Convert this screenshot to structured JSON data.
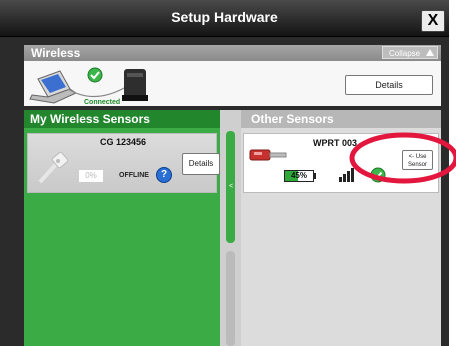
{
  "dialog": {
    "title": "Setup Hardware",
    "close_glyph": "X"
  },
  "wireless": {
    "header_label": "Wireless",
    "collapse_label": "Collapse",
    "status_text": "Connected",
    "details_label": "Details"
  },
  "my_sensors": {
    "header_label": "My Wireless Sensors",
    "cards": [
      {
        "name": "CG 123456",
        "percent": "0%",
        "status": "OFFLINE",
        "details_label": "Details",
        "help_glyph": "?"
      }
    ]
  },
  "other_sensors": {
    "header_label": "Other Sensors",
    "cards": [
      {
        "name": "WPRT 003",
        "battery_label": "45%",
        "battery_level": 0.45,
        "use_label_line1": "<- Use",
        "use_label_line2": "Sensor"
      }
    ]
  },
  "divider": {
    "scroll_arrow_glyph": "<"
  },
  "colors": {
    "accent_green": "#3bab45",
    "header_green": "#22862d",
    "help_blue": "#2a6fd3",
    "annotation_red": "#e3173e"
  }
}
